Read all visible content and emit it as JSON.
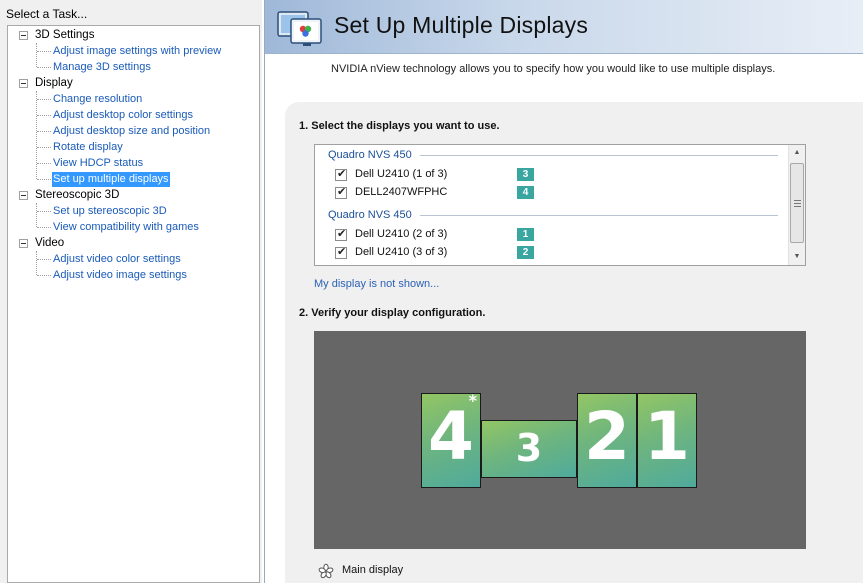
{
  "task_pane": {
    "header": "Select a Task...",
    "tree": [
      {
        "label": "3D Settings",
        "children": [
          "Adjust image settings with preview",
          "Manage 3D settings"
        ]
      },
      {
        "label": "Display",
        "children": [
          "Change resolution",
          "Adjust desktop color settings",
          "Adjust desktop size and position",
          "Rotate display",
          "View HDCP status",
          "Set up multiple displays"
        ]
      },
      {
        "label": "Stereoscopic 3D",
        "children": [
          "Set up stereoscopic 3D",
          "View compatibility with games"
        ]
      },
      {
        "label": "Video",
        "children": [
          "Adjust video color settings",
          "Adjust video image settings"
        ]
      }
    ],
    "selected_item": "Set up multiple displays"
  },
  "page": {
    "title": "Set Up Multiple Displays",
    "description": "NVIDIA nView technology allows you to specify how you would like to use multiple displays.",
    "icon": "multi-display-icon"
  },
  "section1": {
    "heading": "1. Select the displays you want to use.",
    "groups": [
      {
        "gpu": "Quadro NVS 450",
        "displays": [
          {
            "name": "Dell U2410 (1 of 3)",
            "checked": true,
            "badge": "3"
          },
          {
            "name": "DELL2407WFPHC",
            "checked": true,
            "badge": "4"
          }
        ]
      },
      {
        "gpu": "Quadro NVS 450",
        "displays": [
          {
            "name": "Dell U2410 (2 of 3)",
            "checked": true,
            "badge": "1"
          },
          {
            "name": "Dell U2410 (3 of 3)",
            "checked": true,
            "badge": "2"
          }
        ]
      }
    ],
    "not_shown_link": "My display is not shown..."
  },
  "section2": {
    "heading": "2. Verify your display configuration.",
    "monitors": [
      {
        "number": "4",
        "orientation": "portrait",
        "primary": true
      },
      {
        "number": "3",
        "orientation": "landscape",
        "primary": false
      },
      {
        "number": "2",
        "orientation": "portrait",
        "primary": false
      },
      {
        "number": "1",
        "orientation": "portrait",
        "primary": false
      }
    ],
    "primary_marker": "*",
    "legend_label": "Main display"
  },
  "colors": {
    "link": "#1a5bb8",
    "selection": "#3399ff",
    "badge": "#3aa6a0",
    "canvas": "#666666"
  }
}
